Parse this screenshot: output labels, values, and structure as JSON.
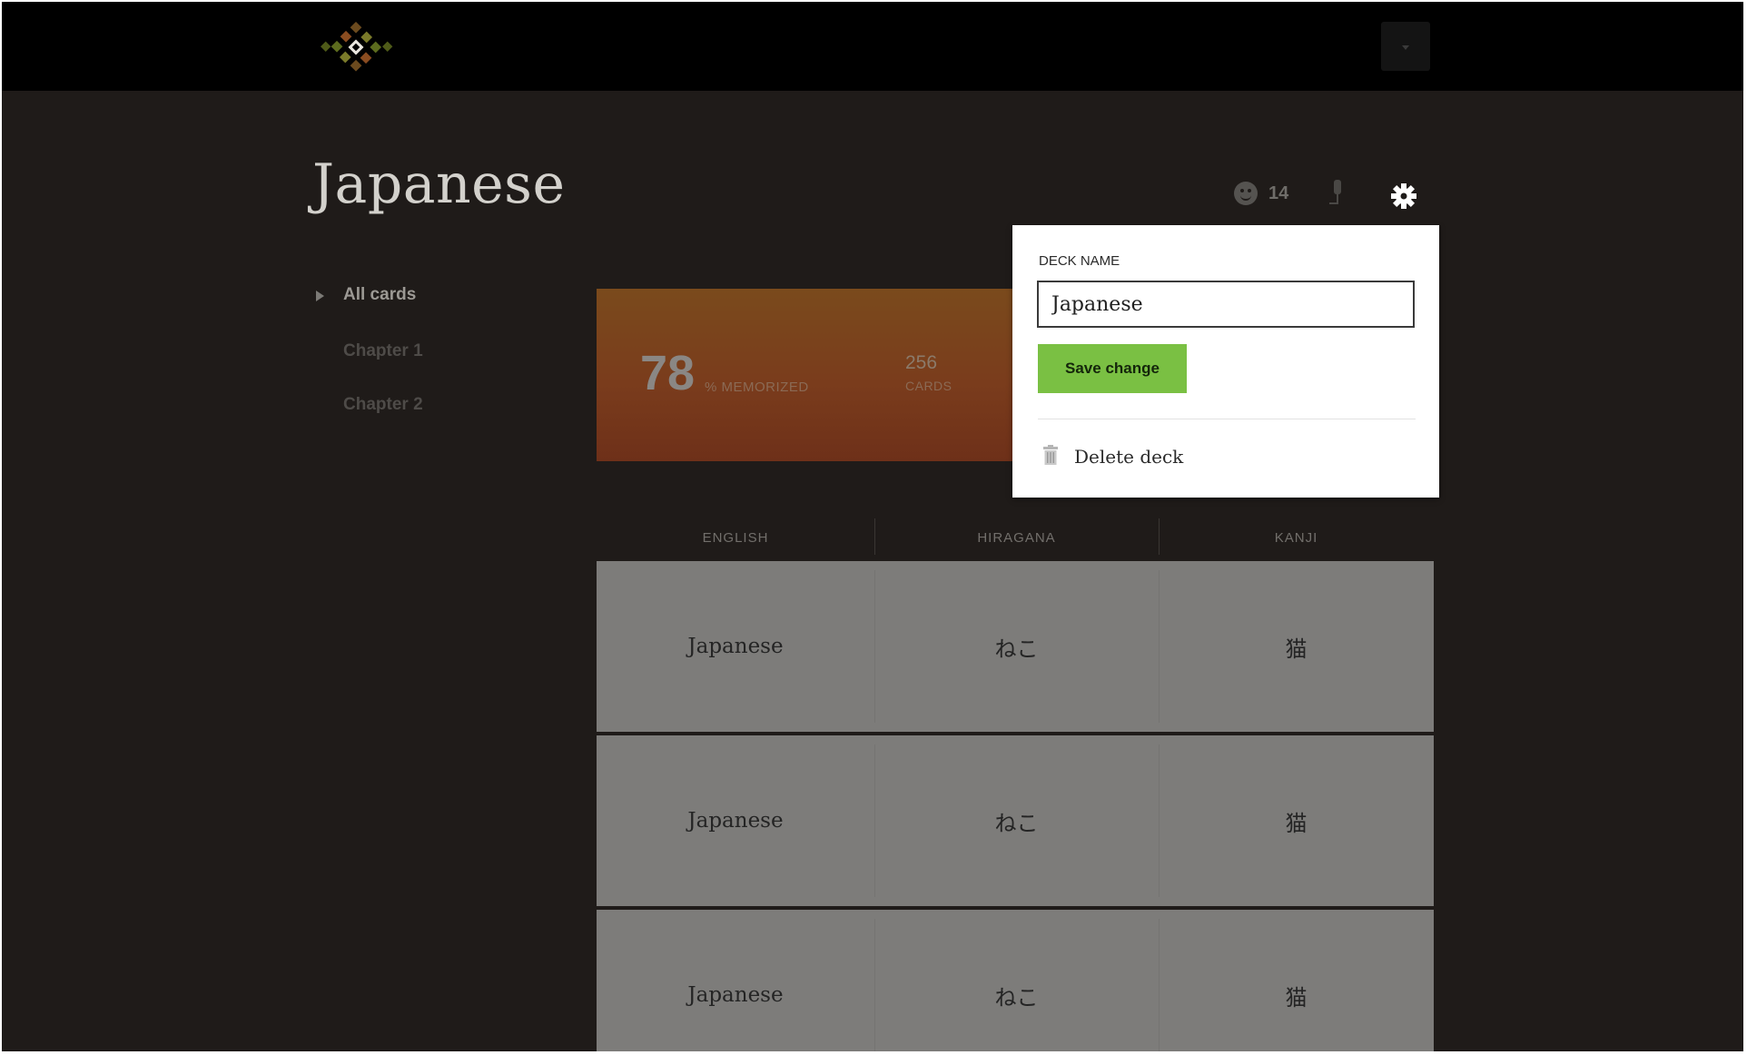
{
  "app": {
    "deck_title": "Japanese",
    "smile_count": "14",
    "icons": {
      "logo": "diamond-logo-icon",
      "menu": "caret-down-icon",
      "smiley": "smiley-icon",
      "microphone": "microphone-icon",
      "settings": "gear-icon",
      "trash": "trash-icon"
    }
  },
  "sidebar": {
    "items": [
      {
        "label": "All cards",
        "active": true
      },
      {
        "label": "Chapter 1",
        "active": false
      },
      {
        "label": "Chapter 2",
        "active": false
      }
    ]
  },
  "stats": {
    "memorized_value": "78",
    "memorized_label": "% MEMORIZED",
    "cards_value": "256",
    "cards_label": "CARDS"
  },
  "settings_popover": {
    "field_label": "DECK NAME",
    "deck_name_value": "Japanese",
    "save_label": "Save change",
    "delete_label": "Delete deck"
  },
  "table": {
    "headers": [
      "ENGLISH",
      "HIRAGANA",
      "KANJI"
    ],
    "rows": [
      [
        "Japanese",
        "ねこ",
        "猫"
      ],
      [
        "Japanese",
        "ねこ",
        "猫"
      ],
      [
        "Japanese",
        "ねこ",
        "猫"
      ]
    ]
  },
  "colors": {
    "background": "#1f1b19",
    "topbar": "#000000",
    "accent_green": "#7ac043",
    "stats_gradient_top": "#7a4a1c",
    "stats_gradient_bottom": "#6e3019",
    "row_background": "#7d7c7a"
  }
}
